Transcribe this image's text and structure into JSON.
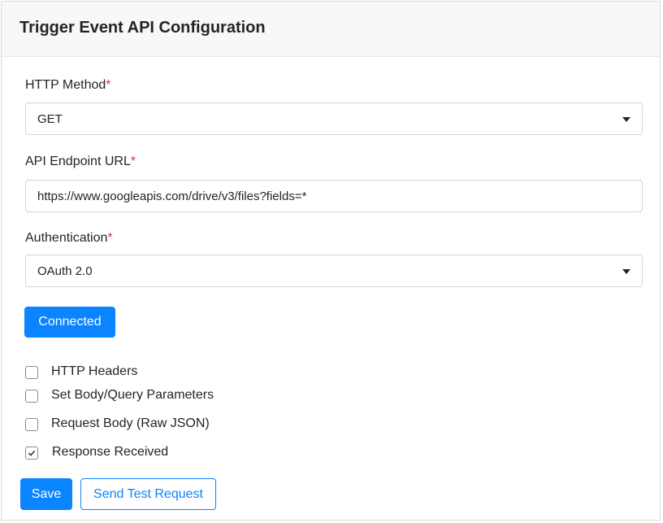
{
  "header": {
    "title": "Trigger Event API Configuration"
  },
  "form": {
    "method": {
      "label": "HTTP Method",
      "required_mark": "*",
      "value": "GET"
    },
    "endpoint": {
      "label": "API Endpoint URL",
      "required_mark": "*",
      "value": "https://www.googleapis.com/drive/v3/files?fields=*"
    },
    "auth": {
      "label": "Authentication",
      "required_mark": "*",
      "value": "OAuth 2.0"
    },
    "connected_label": "Connected",
    "options": [
      {
        "label": "HTTP Headers",
        "checked": false
      },
      {
        "label": "Set Body/Query Parameters",
        "checked": false
      },
      {
        "label": "Request Body (Raw JSON)",
        "checked": false
      },
      {
        "label": "Response Received",
        "checked": true
      }
    ]
  },
  "footer": {
    "save_label": "Save",
    "test_label": "Send Test Request"
  },
  "colors": {
    "primary": "#0a84ff",
    "required": "#dc3545",
    "border": "#ced4da"
  }
}
